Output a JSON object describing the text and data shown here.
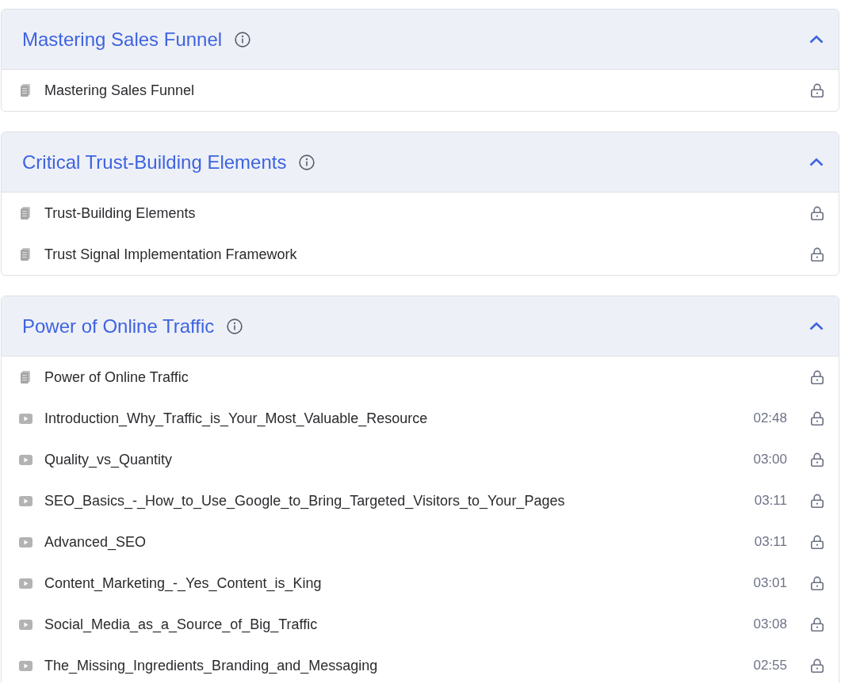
{
  "sections": [
    {
      "title": "Mastering Sales Funnel",
      "expanded": true,
      "lessons": [
        {
          "kind": "document",
          "title": "Mastering Sales Funnel",
          "locked": true
        }
      ]
    },
    {
      "title": "Critical Trust-Building Elements",
      "expanded": true,
      "lessons": [
        {
          "kind": "document",
          "title": "Trust-Building Elements",
          "locked": true
        },
        {
          "kind": "document",
          "title": "Trust Signal Implementation Framework",
          "locked": true
        }
      ]
    },
    {
      "title": "Power of Online Traffic",
      "expanded": true,
      "lessons": [
        {
          "kind": "document",
          "title": "Power of Online Traffic",
          "locked": true
        },
        {
          "kind": "video",
          "title": "Introduction_Why_Traffic_is_Your_Most_Valuable_Resource",
          "duration": "02:48",
          "locked": true
        },
        {
          "kind": "video",
          "title": "Quality_vs_Quantity",
          "duration": "03:00",
          "locked": true
        },
        {
          "kind": "video",
          "title": "SEO_Basics_-_How_to_Use_Google_to_Bring_Targeted_Visitors_to_Your_Pages",
          "duration": "03:11",
          "locked": true
        },
        {
          "kind": "video",
          "title": "Advanced_SEO",
          "duration": "03:11",
          "locked": true
        },
        {
          "kind": "video",
          "title": "Content_Marketing_-_Yes_Content_is_King",
          "duration": "03:01",
          "locked": true
        },
        {
          "kind": "video",
          "title": "Social_Media_as_a_Source_of_Big_Traffic",
          "duration": "03:08",
          "locked": true
        },
        {
          "kind": "video",
          "title": "The_Missing_Ingredients_Branding_and_Messaging",
          "duration": "02:55",
          "locked": true
        }
      ]
    }
  ]
}
